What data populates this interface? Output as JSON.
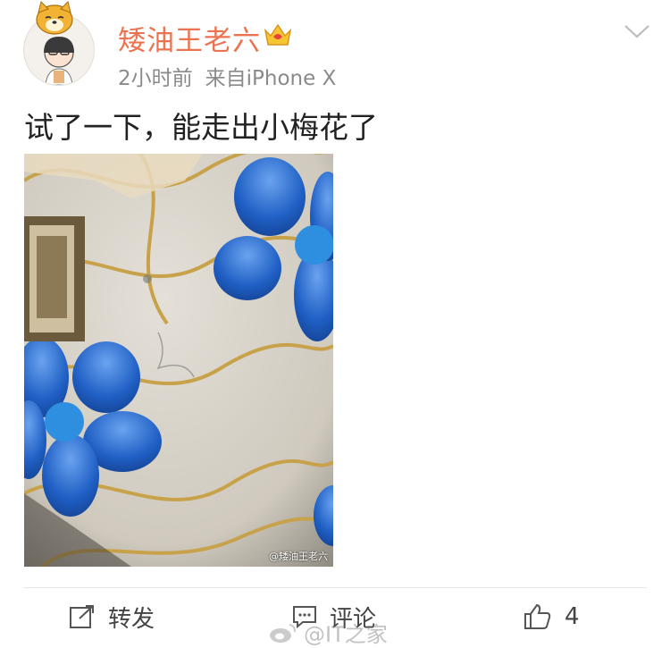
{
  "post": {
    "username": "矮油王老六",
    "time": "2小时前",
    "source": "来自iPhone X",
    "text": "试了一下，能走出小梅花了",
    "photo_watermark": "@矮油王老六",
    "vip_icon": "crown-icon",
    "more_icon": "chevron-down-icon"
  },
  "actions": {
    "repost_label": "转发",
    "comment_label": "评论",
    "like_count": "4"
  },
  "watermark": {
    "text": "@IT之家"
  },
  "colors": {
    "username": "#eb7350",
    "flower_blue": "#1f5fc4",
    "stem_gold": "#c8a24a"
  }
}
